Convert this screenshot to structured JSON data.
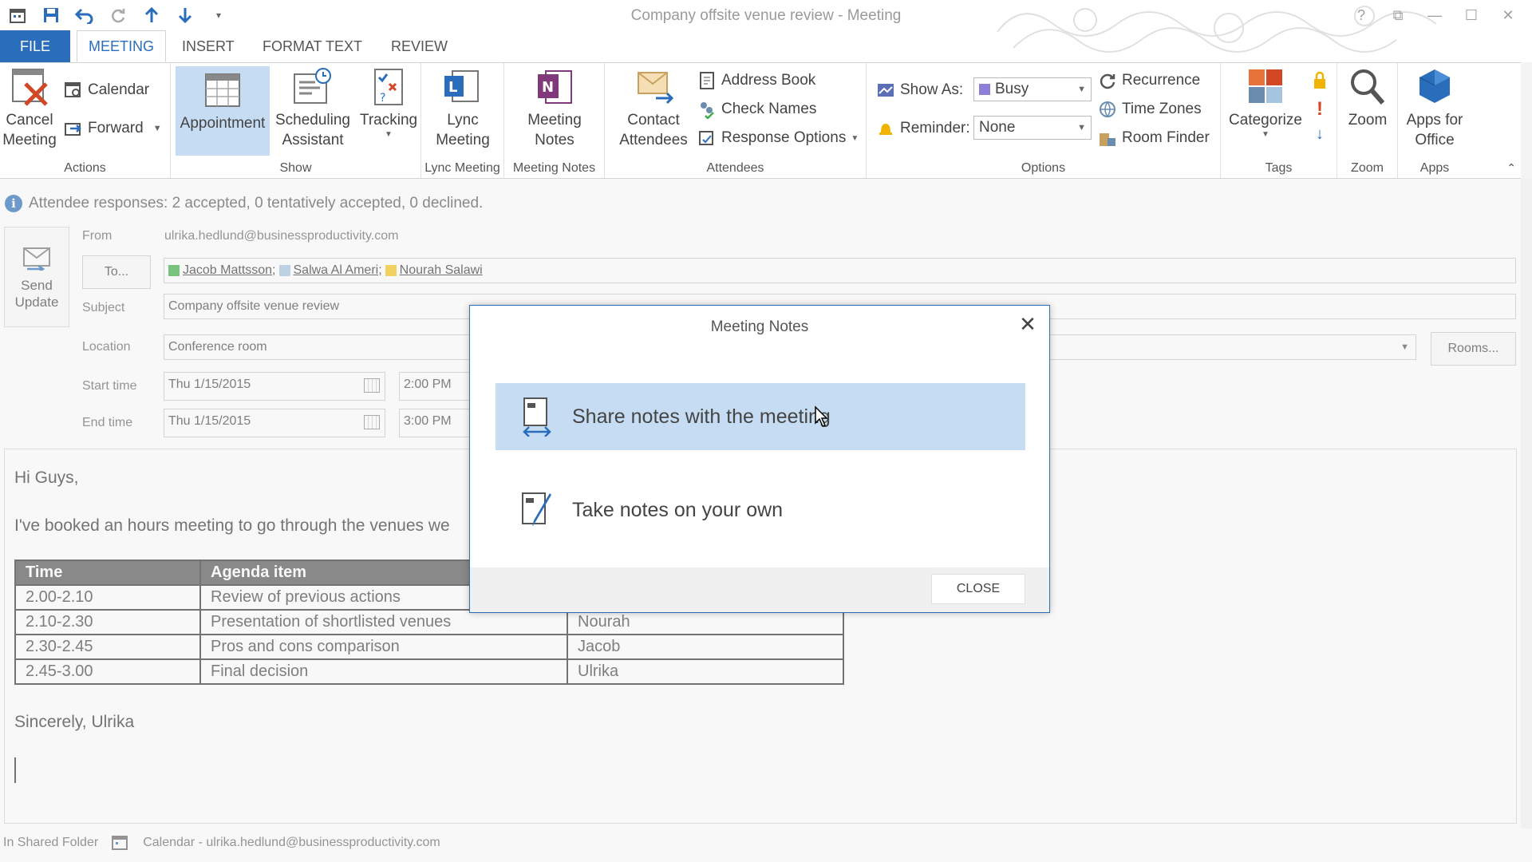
{
  "window": {
    "title": "Company offsite venue review - Meeting",
    "controls": [
      "?",
      "⧉",
      "—",
      "☐",
      "✕"
    ]
  },
  "quick_access": [
    "calendar-icon",
    "save-icon",
    "undo-icon",
    "redo-icon",
    "up-icon",
    "down-icon",
    "customize-icon"
  ],
  "tabs": {
    "file": "FILE",
    "items": [
      "MEETING",
      "INSERT",
      "FORMAT TEXT",
      "REVIEW"
    ]
  },
  "ribbon": {
    "actions": {
      "label": "Actions",
      "cancel": "Cancel Meeting",
      "calendar": "Calendar",
      "forward": "Forward"
    },
    "show": {
      "label": "Show",
      "appointment": "Appointment",
      "scheduling": "Scheduling Assistant",
      "tracking": "Tracking"
    },
    "lync": {
      "label": "Lync Meeting",
      "button": "Lync Meeting"
    },
    "notes": {
      "label": "Meeting Notes",
      "button": "Meeting Notes"
    },
    "attendees": {
      "label": "Attendees",
      "contact": "Contact Attendees",
      "address_book": "Address Book",
      "check_names": "Check Names",
      "response_options": "Response Options"
    },
    "options": {
      "label": "Options",
      "show_as_label": "Show As:",
      "show_as_value": "Busy",
      "reminder_label": "Reminder:",
      "reminder_value": "None",
      "recurrence": "Recurrence",
      "time_zones": "Time Zones",
      "room_finder": "Room Finder"
    },
    "tags": {
      "label": "Tags",
      "categorize": "Categorize"
    },
    "zoom": {
      "label": "Zoom",
      "button": "Zoom"
    },
    "apps": {
      "label": "Apps",
      "button": "Apps for Office"
    }
  },
  "info_bar": "Attendee responses: 2 accepted, 0 tentatively accepted, 0 declined.",
  "form": {
    "send_update": "Send Update",
    "from_label": "From",
    "from_value": "ulrika.hedlund@businessproductivity.com",
    "to_button": "To...",
    "recipients": [
      {
        "name": "Jacob Mattsson;",
        "color": "#3cb043"
      },
      {
        "name": "Salwa Al Ameri;",
        "color": "#a7c4de"
      },
      {
        "name": "Nourah Salawi",
        "color": "#f5c518"
      }
    ],
    "subject_label": "Subject",
    "subject_value": "Company offsite venue review",
    "location_label": "Location",
    "location_value": "Conference room",
    "rooms_button": "Rooms...",
    "start_label": "Start time",
    "start_date": "Thu 1/15/2015",
    "start_time": "2:00 PM",
    "end_label": "End time",
    "end_date": "Thu 1/15/2015",
    "end_time": "3:00 PM"
  },
  "body": {
    "greeting": "Hi Guys,",
    "intro": "I've booked an hours meeting to go through the venues we",
    "table": {
      "headers": [
        "Time",
        "Agenda item",
        ""
      ],
      "rows": [
        [
          "2.00-2.10",
          "Review of previous actions",
          ""
        ],
        [
          "2.10-2.30",
          "Presentation of shortlisted venues",
          "Nourah"
        ],
        [
          "2.30-2.45",
          "Pros and cons comparison",
          "Jacob"
        ],
        [
          "2.45-3.00",
          "Final decision",
          "Ulrika"
        ]
      ]
    },
    "signoff": "Sincerely, Ulrika"
  },
  "status": {
    "folder": "In Shared Folder",
    "calendar": "Calendar - ulrika.hedlund@businessproductivity.com"
  },
  "dialog": {
    "title": "Meeting Notes",
    "option_share": "Share notes with the meeting",
    "option_own": "Take notes on your own",
    "close": "CLOSE"
  },
  "colors": {
    "accent": "#2a6ebb",
    "selected": "#c5dcf2"
  }
}
